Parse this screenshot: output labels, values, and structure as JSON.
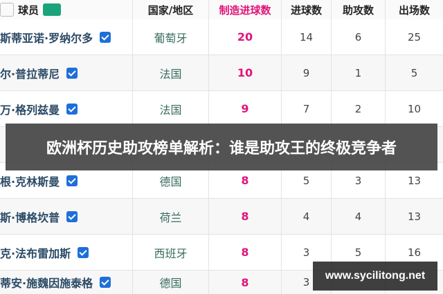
{
  "header": {
    "player": "球员",
    "logo_text": "",
    "country": "国家/地区",
    "created_goals": "制造进球数",
    "goals": "进球数",
    "assists": "助攻数",
    "appearances": "出场数"
  },
  "rows": [
    {
      "player": "斯蒂亚诺·罗纳尔多",
      "country": "葡萄牙",
      "created_goals": "20",
      "goals": "14",
      "assists": "6",
      "appearances": "25"
    },
    {
      "player": "尔·普拉蒂尼",
      "country": "法国",
      "created_goals": "10",
      "goals": "9",
      "assists": "1",
      "appearances": "5"
    },
    {
      "player": "万·格列兹曼",
      "country": "法国",
      "created_goals": "9",
      "goals": "7",
      "assists": "2",
      "appearances": "10"
    },
    {
      "player": "",
      "country": "",
      "created_goals": "",
      "goals": "",
      "assists": "",
      "appearances": ""
    },
    {
      "player": "根·克林斯曼",
      "country": "德国",
      "created_goals": "8",
      "goals": "5",
      "assists": "3",
      "appearances": "13"
    },
    {
      "player": "斯·博格坎普",
      "country": "荷兰",
      "created_goals": "8",
      "goals": "4",
      "assists": "4",
      "appearances": "13"
    },
    {
      "player": "克·法布雷加斯",
      "country": "西班牙",
      "created_goals": "8",
      "goals": "3",
      "assists": "5",
      "appearances": "16"
    },
    {
      "player": "蒂安·施魏因施泰格",
      "country": "德国",
      "created_goals": "8",
      "goals": "3",
      "assists": "",
      "appearances": ""
    }
  ],
  "banner": {
    "title": "欧洲杯历史助攻榜单解析：谁是助攻王的终极竞争者"
  },
  "watermark": {
    "text": "www.sycilitong.net"
  },
  "colors": {
    "accent": "#e0157a",
    "checkbox": "#1e6fd9",
    "player_text": "#2b4a66"
  }
}
